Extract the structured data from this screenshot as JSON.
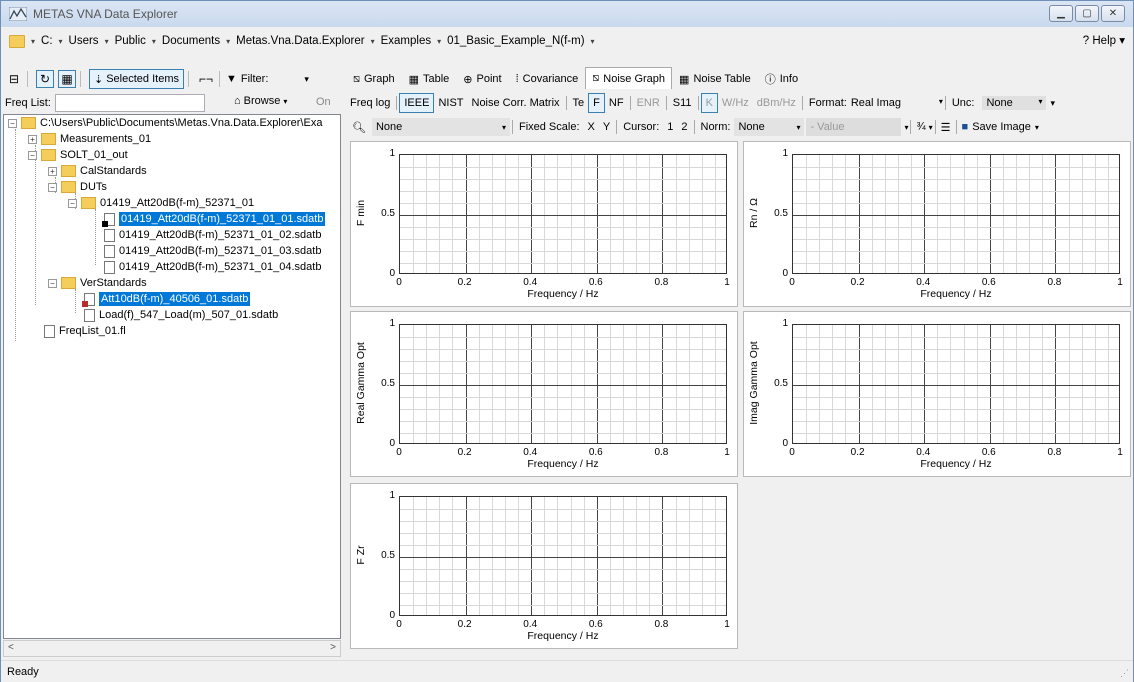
{
  "window": {
    "title": "METAS VNA Data Explorer"
  },
  "address": {
    "crumbs": [
      "C:",
      "Users",
      "Public",
      "Documents",
      "Metas.Vna.Data.Explorer",
      "Examples",
      "01_Basic_Example_N(f-m)"
    ],
    "help": "? Help"
  },
  "left_toolbar": {
    "selected_items": "Selected Items",
    "filter": "Filter:"
  },
  "freq": {
    "label": "Freq List:",
    "browse": "Browse",
    "on": "On"
  },
  "tree": {
    "root": "C:\\Users\\Public\\Documents\\Metas.Vna.Data.Explorer\\Exa",
    "measurements": "Measurements_01",
    "solt": "SOLT_01_out",
    "calstandards": "CalStandards",
    "duts": "DUTs",
    "dut_folder": "01419_Att20dB(f-m)_52371_01",
    "dut_files": [
      "01419_Att20dB(f-m)_52371_01_01.sdatb",
      "01419_Att20dB(f-m)_52371_01_02.sdatb",
      "01419_Att20dB(f-m)_52371_01_03.sdatb",
      "01419_Att20dB(f-m)_52371_01_04.sdatb"
    ],
    "verstandards": "VerStandards",
    "ver_files": [
      "Att10dB(f-m)_40506_01.sdatb",
      "Load(f)_547_Load(m)_507_01.sdatb"
    ],
    "freqlist": "FreqList_01.fl"
  },
  "tabs": [
    "Graph",
    "Table",
    "Point",
    "Covariance",
    "Noise Graph",
    "Noise Table",
    "Info"
  ],
  "toolbar2": {
    "freq_log": "Freq log",
    "ieee": "IEEE",
    "nist": "NIST",
    "ncm": "Noise Corr. Matrix",
    "te": "Te",
    "f": "F",
    "nf": "NF",
    "enr": "ENR",
    "s11": "S11",
    "k": "K",
    "whz": "W/Hz",
    "dbmhz": "dBm/Hz",
    "format_label": "Format:",
    "format_value": "Real Imag",
    "unc_label": "Unc:",
    "unc_value": "None"
  },
  "toolbar3": {
    "search_value": "None",
    "fixed_scale": "Fixed Scale:",
    "x": "X",
    "y": "Y",
    "cursor": "Cursor:",
    "c1": "1",
    "c2": "2",
    "norm": "Norm:",
    "norm_value": "None",
    "value_placeholder": "- Value",
    "save_image": "Save Image"
  },
  "plots": [
    {
      "ylabel": "F min"
    },
    {
      "ylabel": "Rn / Ω"
    },
    {
      "ylabel": "Real Gamma Opt"
    },
    {
      "ylabel": "Imag Gamma Opt"
    },
    {
      "ylabel": "F Zr"
    }
  ],
  "axes": {
    "y_ticks": [
      "1",
      "0.5",
      "0"
    ],
    "x_ticks": [
      "0",
      "0.2",
      "0.4",
      "0.6",
      "0.8",
      "1"
    ],
    "xlabel": "Frequency / Hz"
  },
  "status": {
    "text": "Ready"
  }
}
